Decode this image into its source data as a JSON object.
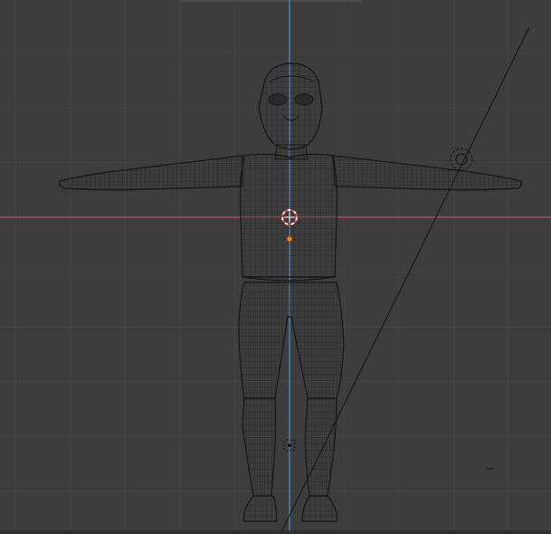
{
  "viewport": {
    "mode": "wireframe",
    "view": "front-orthographic",
    "background_color": "#3d3d3d",
    "grid_color": "#4a4a4a",
    "x_axis_color": "#c0475a",
    "z_axis_color": "#4b7fbf",
    "mesh_color": "#1a1a1a",
    "origin_color": "#f08a1e"
  },
  "scene": {
    "objects": [
      {
        "name": "character-mesh",
        "type": "mesh",
        "pose": "T-pose"
      },
      {
        "name": "3d-cursor",
        "type": "cursor"
      },
      {
        "name": "light",
        "type": "light"
      },
      {
        "name": "camera-empty",
        "type": "empty"
      }
    ]
  }
}
